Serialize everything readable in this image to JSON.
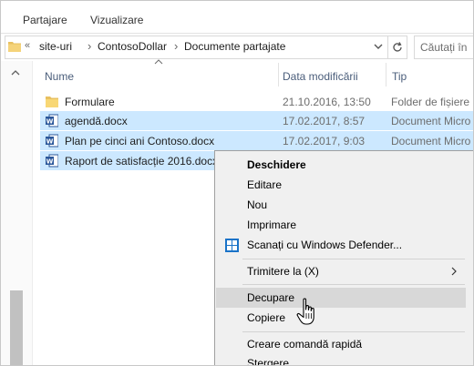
{
  "ribbon": {
    "tabs": [
      "Partajare",
      "Vizualizare"
    ]
  },
  "address": {
    "overflow": "«",
    "crumbs": [
      "site-uri",
      "ContosoDollar",
      "Documente partajate"
    ],
    "separator": "›"
  },
  "search": {
    "placeholder": "Căutați în"
  },
  "columns": {
    "name": "Nume",
    "date": "Data modificării",
    "type": "Tip"
  },
  "files": [
    {
      "name": "Formulare",
      "date": "21.10.2016, 13:50",
      "type": "Folder de fișiere",
      "icon": "folder-icon",
      "selected": false
    },
    {
      "name": "agendă.docx",
      "date": "17.02.2017, 8:57",
      "type": "Document Micro",
      "icon": "word-doc-icon",
      "selected": true
    },
    {
      "name": "Plan pe cinci ani Contoso.docx",
      "date": "17.02.2017, 9:03",
      "type": "Document Micro",
      "icon": "word-doc-icon",
      "selected": true
    },
    {
      "name": "Raport de satisfacție 2016.docx",
      "date": "",
      "type": "",
      "icon": "word-doc-icon",
      "selected": true
    }
  ],
  "context_menu": {
    "items": [
      "Deschidere",
      "Editare",
      "Nou",
      "Imprimare",
      "Scanați cu Windows Defender...",
      "Trimitere la (X)",
      "Decupare",
      "Copiere",
      "Creare comandă rapidă",
      "Ștergere"
    ]
  },
  "colors": {
    "selection": "#cce8ff",
    "menu_bg": "#f0f0f0",
    "hover": "#d8d8d8",
    "header_text": "#4a5d7a"
  }
}
